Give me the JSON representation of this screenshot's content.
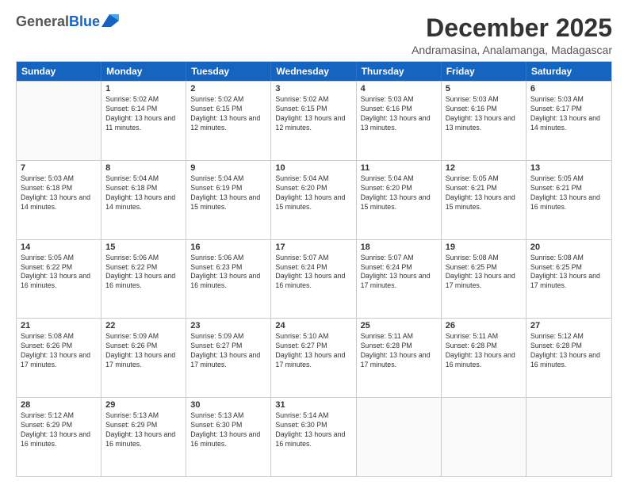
{
  "header": {
    "logo_general": "General",
    "logo_blue": "Blue",
    "month": "December 2025",
    "location": "Andramasina, Analamanga, Madagascar"
  },
  "weekdays": [
    "Sunday",
    "Monday",
    "Tuesday",
    "Wednesday",
    "Thursday",
    "Friday",
    "Saturday"
  ],
  "rows": [
    [
      {
        "day": "",
        "empty": true
      },
      {
        "day": "1",
        "sunrise": "5:02 AM",
        "sunset": "6:14 PM",
        "daylight": "13 hours and 11 minutes."
      },
      {
        "day": "2",
        "sunrise": "5:02 AM",
        "sunset": "6:15 PM",
        "daylight": "13 hours and 12 minutes."
      },
      {
        "day": "3",
        "sunrise": "5:02 AM",
        "sunset": "6:15 PM",
        "daylight": "13 hours and 12 minutes."
      },
      {
        "day": "4",
        "sunrise": "5:03 AM",
        "sunset": "6:16 PM",
        "daylight": "13 hours and 13 minutes."
      },
      {
        "day": "5",
        "sunrise": "5:03 AM",
        "sunset": "6:16 PM",
        "daylight": "13 hours and 13 minutes."
      },
      {
        "day": "6",
        "sunrise": "5:03 AM",
        "sunset": "6:17 PM",
        "daylight": "13 hours and 14 minutes."
      }
    ],
    [
      {
        "day": "7",
        "sunrise": "5:03 AM",
        "sunset": "6:18 PM",
        "daylight": "13 hours and 14 minutes."
      },
      {
        "day": "8",
        "sunrise": "5:04 AM",
        "sunset": "6:18 PM",
        "daylight": "13 hours and 14 minutes."
      },
      {
        "day": "9",
        "sunrise": "5:04 AM",
        "sunset": "6:19 PM",
        "daylight": "13 hours and 15 minutes."
      },
      {
        "day": "10",
        "sunrise": "5:04 AM",
        "sunset": "6:20 PM",
        "daylight": "13 hours and 15 minutes."
      },
      {
        "day": "11",
        "sunrise": "5:04 AM",
        "sunset": "6:20 PM",
        "daylight": "13 hours and 15 minutes."
      },
      {
        "day": "12",
        "sunrise": "5:05 AM",
        "sunset": "6:21 PM",
        "daylight": "13 hours and 15 minutes."
      },
      {
        "day": "13",
        "sunrise": "5:05 AM",
        "sunset": "6:21 PM",
        "daylight": "13 hours and 16 minutes."
      }
    ],
    [
      {
        "day": "14",
        "sunrise": "5:05 AM",
        "sunset": "6:22 PM",
        "daylight": "13 hours and 16 minutes."
      },
      {
        "day": "15",
        "sunrise": "5:06 AM",
        "sunset": "6:22 PM",
        "daylight": "13 hours and 16 minutes."
      },
      {
        "day": "16",
        "sunrise": "5:06 AM",
        "sunset": "6:23 PM",
        "daylight": "13 hours and 16 minutes."
      },
      {
        "day": "17",
        "sunrise": "5:07 AM",
        "sunset": "6:24 PM",
        "daylight": "13 hours and 16 minutes."
      },
      {
        "day": "18",
        "sunrise": "5:07 AM",
        "sunset": "6:24 PM",
        "daylight": "13 hours and 17 minutes."
      },
      {
        "day": "19",
        "sunrise": "5:08 AM",
        "sunset": "6:25 PM",
        "daylight": "13 hours and 17 minutes."
      },
      {
        "day": "20",
        "sunrise": "5:08 AM",
        "sunset": "6:25 PM",
        "daylight": "13 hours and 17 minutes."
      }
    ],
    [
      {
        "day": "21",
        "sunrise": "5:08 AM",
        "sunset": "6:26 PM",
        "daylight": "13 hours and 17 minutes."
      },
      {
        "day": "22",
        "sunrise": "5:09 AM",
        "sunset": "6:26 PM",
        "daylight": "13 hours and 17 minutes."
      },
      {
        "day": "23",
        "sunrise": "5:09 AM",
        "sunset": "6:27 PM",
        "daylight": "13 hours and 17 minutes."
      },
      {
        "day": "24",
        "sunrise": "5:10 AM",
        "sunset": "6:27 PM",
        "daylight": "13 hours and 17 minutes."
      },
      {
        "day": "25",
        "sunrise": "5:11 AM",
        "sunset": "6:28 PM",
        "daylight": "13 hours and 17 minutes."
      },
      {
        "day": "26",
        "sunrise": "5:11 AM",
        "sunset": "6:28 PM",
        "daylight": "13 hours and 16 minutes."
      },
      {
        "day": "27",
        "sunrise": "5:12 AM",
        "sunset": "6:28 PM",
        "daylight": "13 hours and 16 minutes."
      }
    ],
    [
      {
        "day": "28",
        "sunrise": "5:12 AM",
        "sunset": "6:29 PM",
        "daylight": "13 hours and 16 minutes."
      },
      {
        "day": "29",
        "sunrise": "5:13 AM",
        "sunset": "6:29 PM",
        "daylight": "13 hours and 16 minutes."
      },
      {
        "day": "30",
        "sunrise": "5:13 AM",
        "sunset": "6:30 PM",
        "daylight": "13 hours and 16 minutes."
      },
      {
        "day": "31",
        "sunrise": "5:14 AM",
        "sunset": "6:30 PM",
        "daylight": "13 hours and 16 minutes."
      },
      {
        "day": "",
        "empty": true
      },
      {
        "day": "",
        "empty": true
      },
      {
        "day": "",
        "empty": true
      }
    ]
  ]
}
